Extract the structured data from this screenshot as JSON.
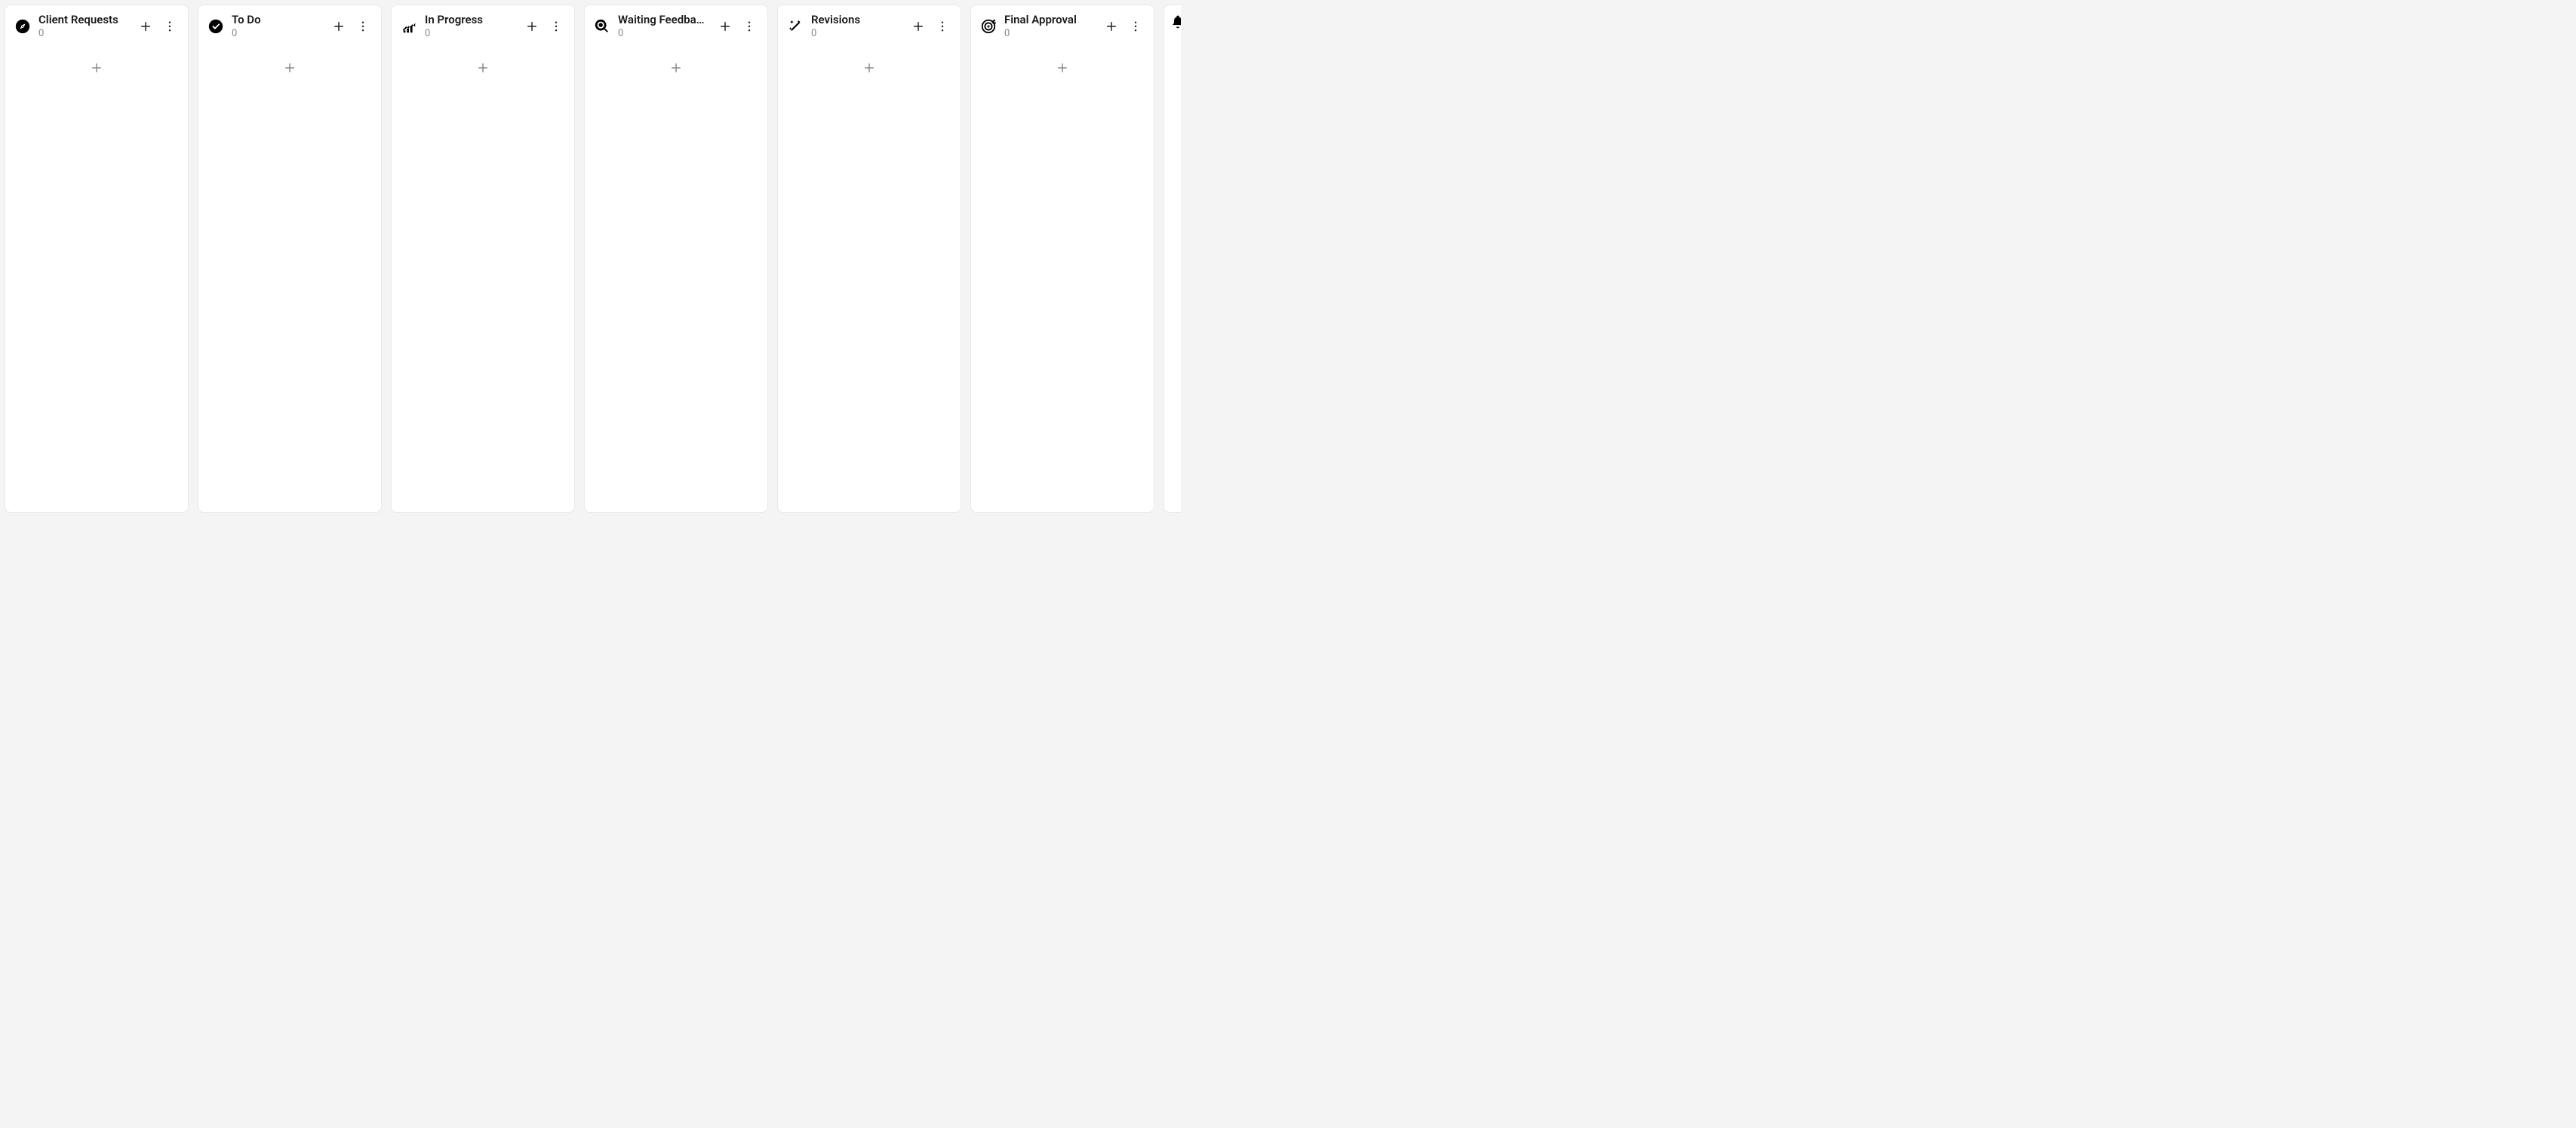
{
  "board": {
    "columns": [
      {
        "title": "Client Requests",
        "count": "0",
        "icon": "compass-icon"
      },
      {
        "title": "To Do",
        "count": "0",
        "icon": "checkcircle-icon"
      },
      {
        "title": "In Progress",
        "count": "0",
        "icon": "trending-icon"
      },
      {
        "title": "Waiting Feedback",
        "count": "0",
        "icon": "magnify-icon"
      },
      {
        "title": "Revisions",
        "count": "0",
        "icon": "magicwand-icon"
      },
      {
        "title": "Final Approval",
        "count": "0",
        "icon": "target-icon"
      }
    ],
    "next_partial_icon": "bell-icon"
  }
}
